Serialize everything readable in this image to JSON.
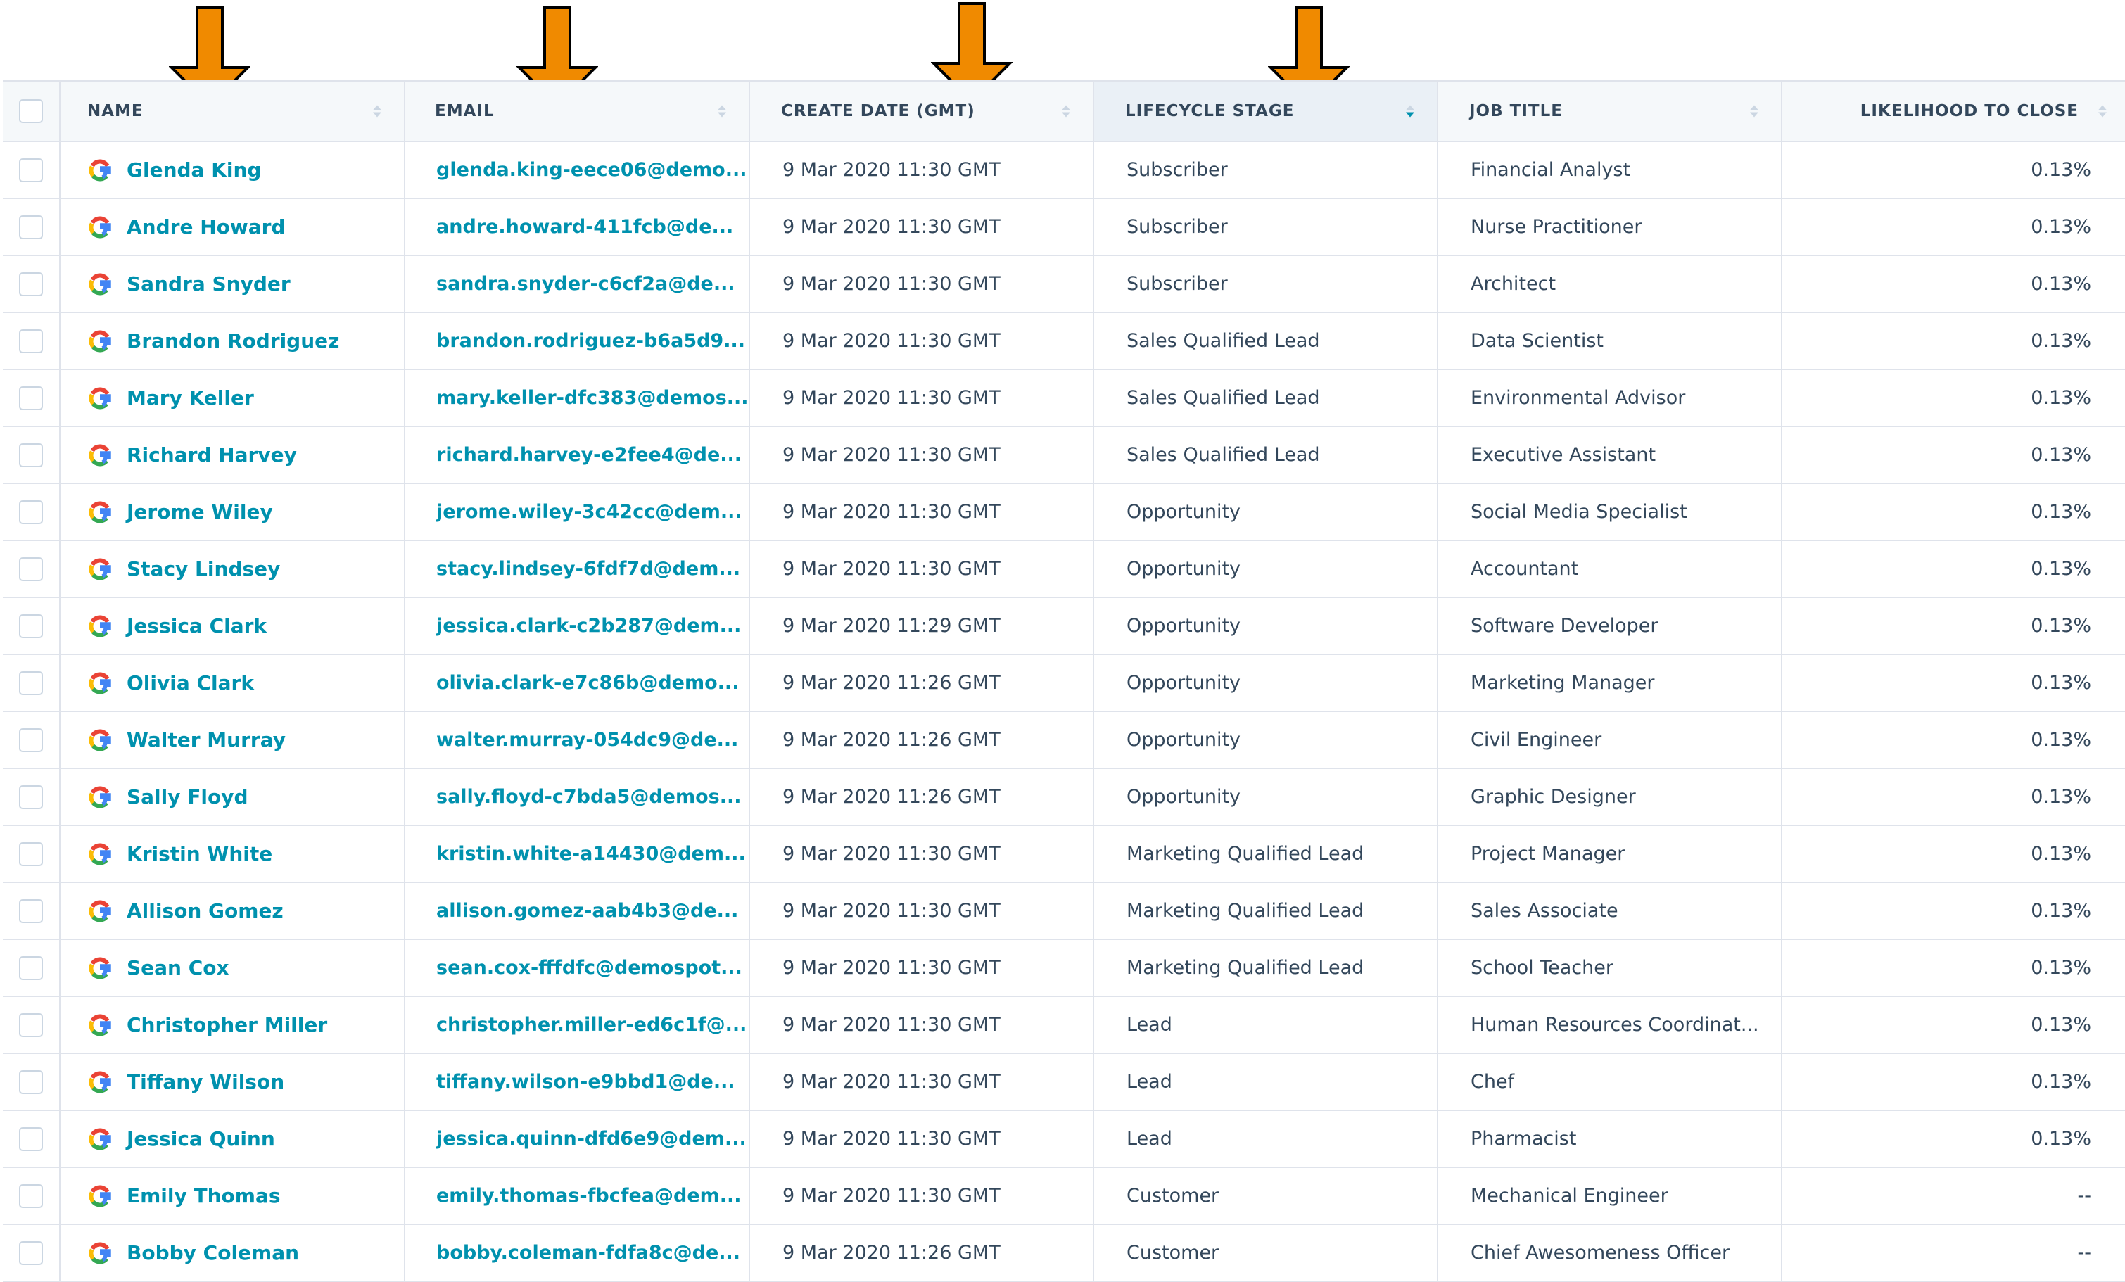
{
  "colors": {
    "link": "#0091ae",
    "text": "#33475b",
    "header_bg": "#f5f8fa",
    "sorted_header_bg": "#eaf0f6",
    "border": "#dfe3eb",
    "arrow_fill": "#f08a00",
    "arrow_stroke": "#000000"
  },
  "header": {
    "name": "NAME",
    "email": "EMAIL",
    "create_date": "CREATE DATE (GMT)",
    "lifecycle_stage": "LIFECYCLE STAGE",
    "job_title": "JOB TITLE",
    "likelihood": "LIKELIHOOD TO CLOSE",
    "sorted_column": "lifecycle_stage",
    "sort_direction": "descending"
  },
  "annotations": {
    "arrow_icon": "down-arrow-icon",
    "arrows_point_to": [
      "NAME",
      "EMAIL",
      "CREATE DATE (GMT)",
      "LIFECYCLE STAGE"
    ]
  },
  "row_icon": "google-source-icon",
  "rows": [
    {
      "name": "Glenda King",
      "email": "glenda.king-eece06@demo...",
      "date": "9 Mar 2020 11:30 GMT",
      "stage": "Subscriber",
      "job": "Financial Analyst",
      "likelihood": "0.13%"
    },
    {
      "name": "Andre Howard",
      "email": "andre.howard-411fcb@de...",
      "date": "9 Mar 2020 11:30 GMT",
      "stage": "Subscriber",
      "job": "Nurse Practitioner",
      "likelihood": "0.13%"
    },
    {
      "name": "Sandra Snyder",
      "email": "sandra.snyder-c6cf2a@de...",
      "date": "9 Mar 2020 11:30 GMT",
      "stage": "Subscriber",
      "job": "Architect",
      "likelihood": "0.13%"
    },
    {
      "name": "Brandon Rodriguez",
      "email": "brandon.rodriguez-b6a5d9...",
      "date": "9 Mar 2020 11:30 GMT",
      "stage": "Sales Qualified Lead",
      "job": "Data Scientist",
      "likelihood": "0.13%"
    },
    {
      "name": "Mary Keller",
      "email": "mary.keller-dfc383@demos...",
      "date": "9 Mar 2020 11:30 GMT",
      "stage": "Sales Qualified Lead",
      "job": "Environmental Advisor",
      "likelihood": "0.13%"
    },
    {
      "name": "Richard Harvey",
      "email": "richard.harvey-e2fee4@de...",
      "date": "9 Mar 2020 11:30 GMT",
      "stage": "Sales Qualified Lead",
      "job": "Executive Assistant",
      "likelihood": "0.13%"
    },
    {
      "name": "Jerome Wiley",
      "email": "jerome.wiley-3c42cc@dem...",
      "date": "9 Mar 2020 11:30 GMT",
      "stage": "Opportunity",
      "job": "Social Media Specialist",
      "likelihood": "0.13%"
    },
    {
      "name": "Stacy Lindsey",
      "email": "stacy.lindsey-6fdf7d@dem...",
      "date": "9 Mar 2020 11:30 GMT",
      "stage": "Opportunity",
      "job": "Accountant",
      "likelihood": "0.13%"
    },
    {
      "name": "Jessica Clark",
      "email": "jessica.clark-c2b287@dem...",
      "date": "9 Mar 2020 11:29 GMT",
      "stage": "Opportunity",
      "job": "Software Developer",
      "likelihood": "0.13%"
    },
    {
      "name": "Olivia Clark",
      "email": "olivia.clark-e7c86b@demo...",
      "date": "9 Mar 2020 11:26 GMT",
      "stage": "Opportunity",
      "job": "Marketing Manager",
      "likelihood": "0.13%"
    },
    {
      "name": "Walter Murray",
      "email": "walter.murray-054dc9@de...",
      "date": "9 Mar 2020 11:26 GMT",
      "stage": "Opportunity",
      "job": "Civil Engineer",
      "likelihood": "0.13%"
    },
    {
      "name": "Sally Floyd",
      "email": "sally.floyd-c7bda5@demos...",
      "date": "9 Mar 2020 11:26 GMT",
      "stage": "Opportunity",
      "job": "Graphic Designer",
      "likelihood": "0.13%"
    },
    {
      "name": "Kristin White",
      "email": "kristin.white-a14430@dem...",
      "date": "9 Mar 2020 11:30 GMT",
      "stage": "Marketing Qualified Lead",
      "job": "Project Manager",
      "likelihood": "0.13%"
    },
    {
      "name": "Allison Gomez",
      "email": "allison.gomez-aab4b3@de...",
      "date": "9 Mar 2020 11:30 GMT",
      "stage": "Marketing Qualified Lead",
      "job": "Sales Associate",
      "likelihood": "0.13%"
    },
    {
      "name": "Sean Cox",
      "email": "sean.cox-fffdfc@demospot...",
      "date": "9 Mar 2020 11:30 GMT",
      "stage": "Marketing Qualified Lead",
      "job": "School Teacher",
      "likelihood": "0.13%"
    },
    {
      "name": "Christopher Miller",
      "email": "christopher.miller-ed6c1f@...",
      "date": "9 Mar 2020 11:30 GMT",
      "stage": "Lead",
      "job": "Human Resources Coordinat...",
      "likelihood": "0.13%"
    },
    {
      "name": "Tiffany Wilson",
      "email": "tiffany.wilson-e9bbd1@de...",
      "date": "9 Mar 2020 11:30 GMT",
      "stage": "Lead",
      "job": "Chef",
      "likelihood": "0.13%"
    },
    {
      "name": "Jessica Quinn",
      "email": "jessica.quinn-dfd6e9@dem...",
      "date": "9 Mar 2020 11:30 GMT",
      "stage": "Lead",
      "job": "Pharmacist",
      "likelihood": "0.13%"
    },
    {
      "name": "Emily Thomas",
      "email": "emily.thomas-fbcfea@dem...",
      "date": "9 Mar 2020 11:30 GMT",
      "stage": "Customer",
      "job": "Mechanical Engineer",
      "likelihood": "--"
    },
    {
      "name": "Bobby Coleman",
      "email": "bobby.coleman-fdfa8c@de...",
      "date": "9 Mar 2020 11:26 GMT",
      "stage": "Customer",
      "job": "Chief Awesomeness Officer",
      "likelihood": "--"
    }
  ]
}
